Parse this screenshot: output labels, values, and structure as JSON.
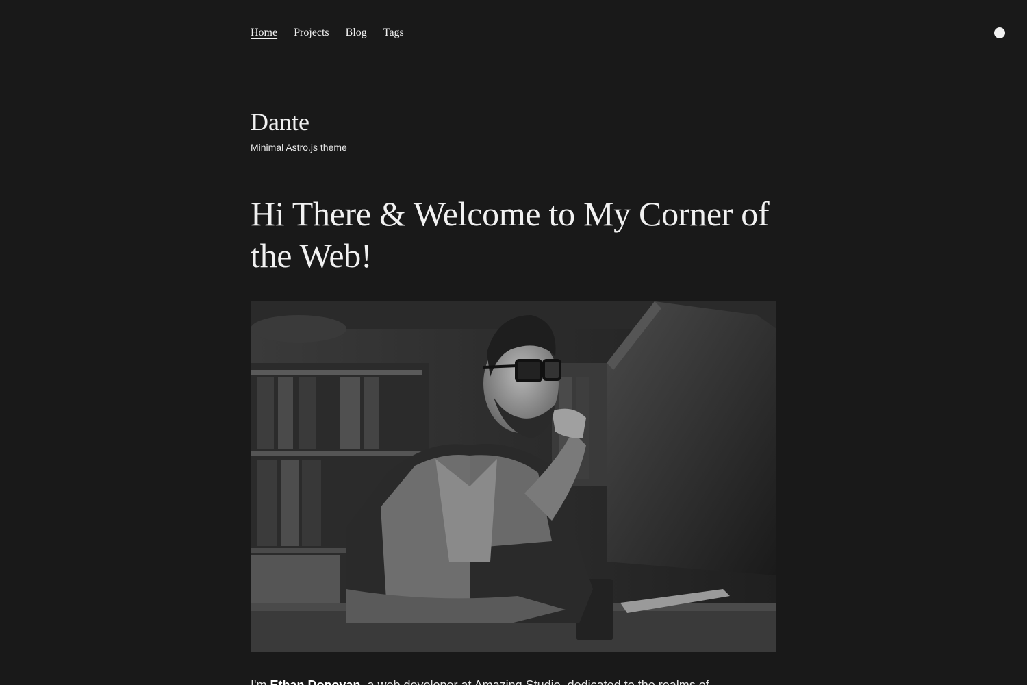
{
  "nav": {
    "items": [
      {
        "label": "Home",
        "active": true
      },
      {
        "label": "Projects",
        "active": false
      },
      {
        "label": "Blog",
        "active": false
      },
      {
        "label": "Tags",
        "active": false
      }
    ]
  },
  "header": {
    "site_title": "Dante",
    "tagline": "Minimal Astro.js theme"
  },
  "hero": {
    "title": "Hi There & Welcome to My Corner of the Web!"
  },
  "intro": {
    "prefix": "I'm ",
    "name": "Ethan Donovan",
    "suffix": ", a web developer at Amazing Studio, dedicated to the realms of"
  },
  "theme": {
    "background": "#191919",
    "text": "#f1f1f1"
  },
  "icons": {
    "theme_toggle": "circle-icon"
  }
}
